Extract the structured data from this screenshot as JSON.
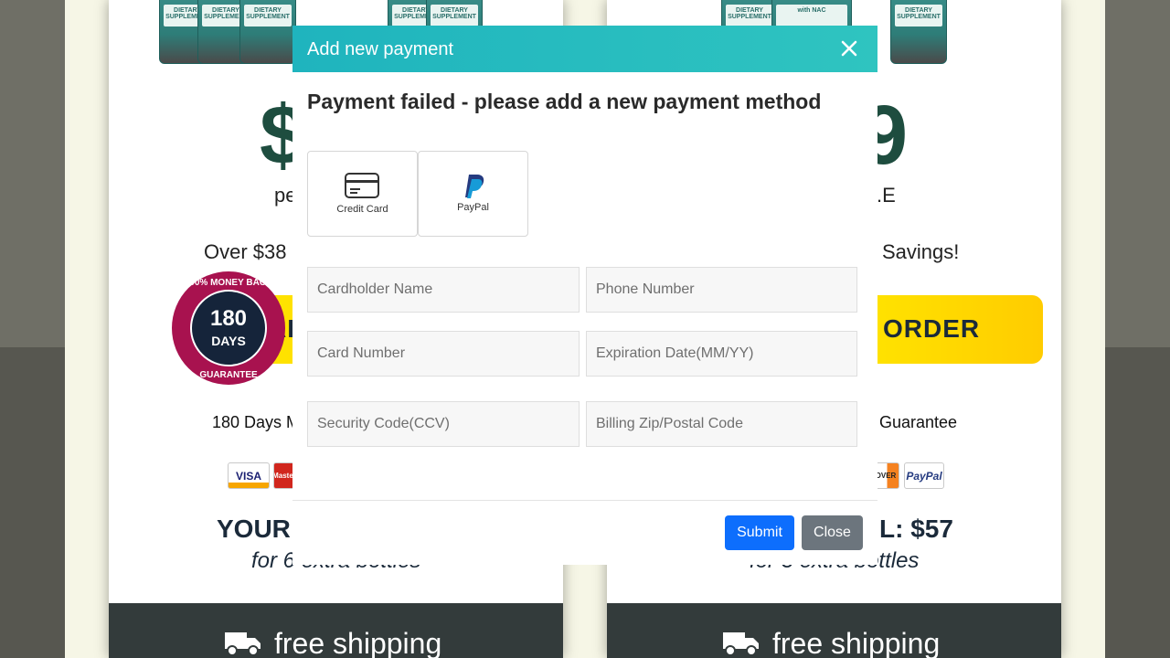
{
  "background": {
    "left_card": {
      "price_partial": "$",
      "per_partial": "pe",
      "savings_partial": "Over $38",
      "order_partial": "AI",
      "guarantee_partial": "180 Days M",
      "total_partial": "YOUR",
      "extra_partial": "for 6 extra bottles",
      "shipping": "free shipping",
      "badge": {
        "top": "100% MONEY BACK",
        "number": "180",
        "unit": "DAYS",
        "bottom": "GUARANTEE"
      },
      "payment_logos": [
        "VISA",
        "Master"
      ]
    },
    "right_card": {
      "price_partial": "9",
      "per_partial": ".E",
      "savings_partial": "Savings!",
      "order_partial": "ORDER",
      "guarantee_partial": "Guarantee",
      "total_partial": "L: $57",
      "extra_partial": "for 3 extra bottles",
      "shipping": "free shipping",
      "payment_logos": [
        "OVER",
        "PayPal"
      ]
    },
    "bottle_label": "DIETARY SUPPLEMENT",
    "bottle_label_nac": "with NAC",
    "colors": {
      "brand_green": "#1e4d3f",
      "order_yellow": "#ffd400",
      "shipping_bar": "#333b3b"
    }
  },
  "modal": {
    "title": "Add new payment",
    "close_icon": "close-icon",
    "message": "Payment failed - please add a new payment method",
    "methods": [
      {
        "label": "Credit Card",
        "icon": "credit-card-icon"
      },
      {
        "label": "PayPal",
        "icon": "paypal-icon"
      }
    ],
    "fields": {
      "cardholder_name": "Cardholder Name",
      "phone_number": "Phone Number",
      "card_number": "Card Number",
      "expiration_date": "Expiration Date(MM/YY)",
      "security_code": "Security Code(CCV)",
      "billing_zip": "Billing Zip/Postal Code"
    },
    "submit_label": "Submit",
    "close_label": "Close",
    "colors": {
      "header": "#1fb4be",
      "submit": "#0d6efd",
      "close": "#6c757d"
    }
  }
}
